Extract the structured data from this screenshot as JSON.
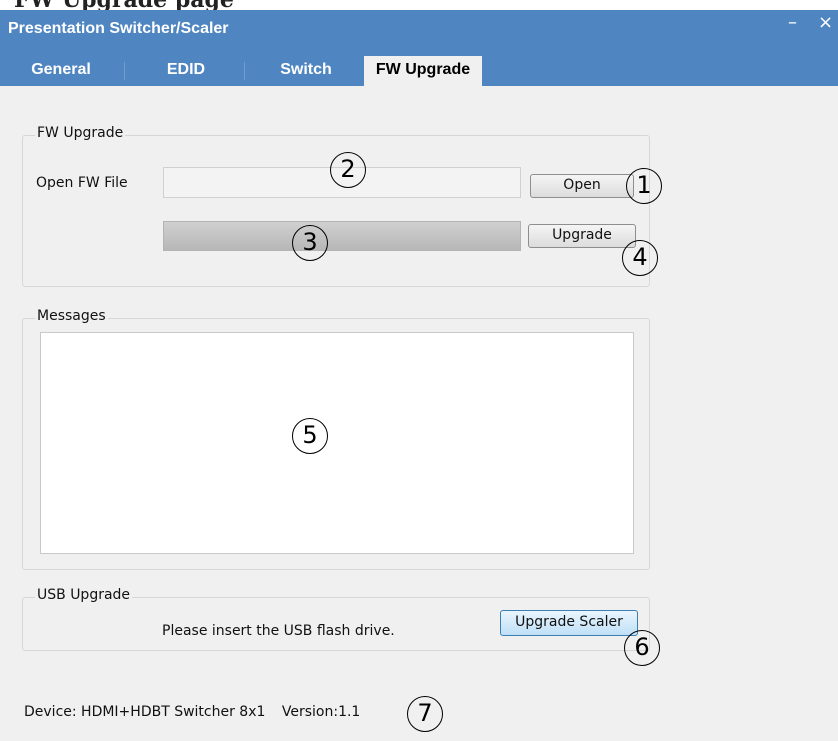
{
  "header_cut_text": "FW Upgrade page",
  "window": {
    "title": "Presentation Switcher/Scaler",
    "minimize_glyph": "–",
    "close_glyph": "×"
  },
  "tabs": [
    {
      "label": "General"
    },
    {
      "label": "EDID"
    },
    {
      "label": "Switch"
    },
    {
      "label": "FW Upgrade",
      "active": true
    }
  ],
  "fw_upgrade": {
    "legend": "FW Upgrade",
    "open_label": "Open FW File",
    "file_value": "",
    "open_button": "Open",
    "upgrade_button": "Upgrade",
    "progress": 0
  },
  "messages": {
    "legend": "Messages",
    "content": ""
  },
  "usb_upgrade": {
    "legend": "USB Upgrade",
    "instruction": "Please insert the USB flash drive.",
    "button": "Upgrade Scaler"
  },
  "status": {
    "device": "Device: HDMI+HDBT Switcher 8x1",
    "version": "Version:1.1"
  },
  "callouts": [
    "1",
    "2",
    "3",
    "4",
    "5",
    "6",
    "7"
  ],
  "colors": {
    "titlebar": "#4f86c2",
    "window_bg": "#f0f0f0",
    "accent_button": "#bfe0f7"
  }
}
